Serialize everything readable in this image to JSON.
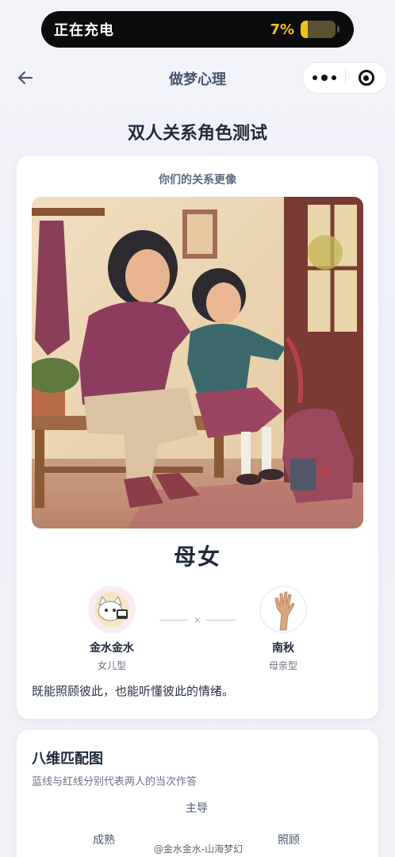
{
  "status": {
    "text": "正在充电",
    "battery_percent_text": "7%",
    "battery_level": 0.07,
    "accent_color": "#f2c21b"
  },
  "nav": {
    "title": "做梦心理"
  },
  "page": {
    "title": "双人关系角色测试"
  },
  "result": {
    "subtitle": "你们的关系更像",
    "name": "母女",
    "description": "既能照顾彼此，也能听懂彼此的情绪。",
    "connector_symbol": "×",
    "person_left": {
      "name": "金水金水",
      "type": "女儿型"
    },
    "person_right": {
      "name": "南秋",
      "type": "母亲型"
    }
  },
  "dimension": {
    "title": "八维匹配图",
    "subtitle": "蓝线与红线分别代表两人的当次作答",
    "labels": {
      "top": "主导",
      "left": "成熟",
      "right": "照顾"
    }
  },
  "watermark": "@金水金水-山海梦幻"
}
